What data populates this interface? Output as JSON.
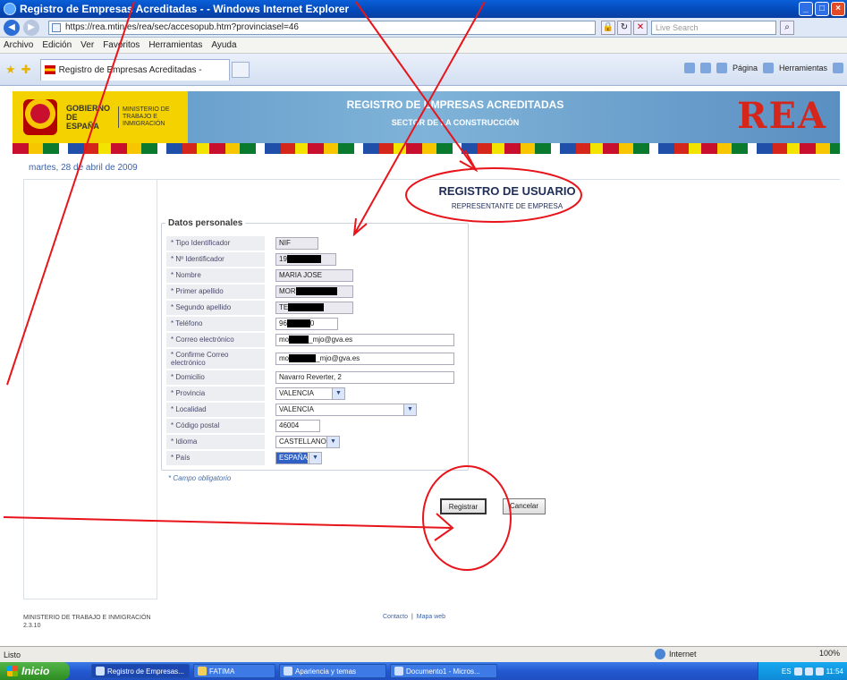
{
  "window": {
    "title": "Registro de Empresas Acreditadas - - Windows Internet Explorer",
    "controls": [
      "_",
      "□",
      "×"
    ]
  },
  "address_bar": {
    "url": "https://rea.mtin.es/rea/sec/accesopub.htm?provinciasel=46",
    "search_placeholder": "Live Search"
  },
  "menu": {
    "items": [
      "Archivo",
      "Edición",
      "Ver",
      "Favoritos",
      "Herramientas",
      "Ayuda"
    ]
  },
  "tabs": {
    "active_tab": "Registro de Empresas Acreditadas -"
  },
  "command_bar": {
    "items": [
      "Página",
      "Herramientas"
    ]
  },
  "banner": {
    "gobierno": "GOBIERNO DE ESPAÑA",
    "ministerio": "MINISTERIO DE TRABAJO E INMIGRACIÓN",
    "title": "REGISTRO DE EMPRESAS ACREDITADAS",
    "subtitle": "SECTOR DE LA CONSTRUCCIÓN",
    "logo": "REA"
  },
  "date": "martes, 28 de abril de 2009",
  "page": {
    "title": "REGISTRO DE USUARIO",
    "subtitle": "REPRESENTANTE DE EMPRESA",
    "fieldset_legend": "Datos personales",
    "required_note": "* Campo obligatorio"
  },
  "form": {
    "tipo_identificador": {
      "label": "* Tipo Identificador",
      "value": "NIF"
    },
    "num_identificador": {
      "label": "* Nº Identificador",
      "value": "19"
    },
    "nombre": {
      "label": "* Nombre",
      "value": "MARIA JOSE"
    },
    "primer_apellido": {
      "label": "* Primer apellido",
      "value": "MOR"
    },
    "segundo_apellido": {
      "label": "* Segundo apellido",
      "value": "TE"
    },
    "telefono": {
      "label": "* Teléfono",
      "value_prefix": "96",
      "value_suffix": "0"
    },
    "correo": {
      "label": "* Correo electrónico",
      "value_prefix": "mo",
      "value_suffix": "_mjo@gva.es"
    },
    "confirme_correo": {
      "label": "* Confirme Correo electrónico",
      "value_prefix": "mo",
      "value_suffix": "_mjo@gva.es"
    },
    "domicilio": {
      "label": "* Domicilio",
      "value": "Navarro Reverter, 2"
    },
    "provincia": {
      "label": "* Provincia",
      "value": "VALENCIA"
    },
    "localidad": {
      "label": "* Localidad",
      "value": "VALENCIA"
    },
    "codigo_postal": {
      "label": "* Código postal",
      "value": "46004"
    },
    "idioma": {
      "label": "* Idioma",
      "value": "CASTELLANO"
    },
    "pais": {
      "label": "* País",
      "value": "ESPAÑA"
    }
  },
  "buttons": {
    "registrar": "Registrar",
    "cancelar": "Cancelar"
  },
  "footer": {
    "ministry": "MINISTERIO DE TRABAJO E INMIGRACIÓN",
    "version": "2.3.10",
    "contacto": "Contacto",
    "mapa_web": "Mapa web",
    "separator": "|"
  },
  "status_bar": {
    "status": "Listo",
    "zone": "Internet",
    "zoom": "100%"
  },
  "taskbar": {
    "start": "Inicio",
    "tasks": [
      "Registro de Empresas...",
      "FATIMA",
      "Apariencia y temas",
      "Documento1 - Micros..."
    ],
    "tray_lang": "ES",
    "clock": "11:54"
  },
  "annotation_color": "#e8141b"
}
